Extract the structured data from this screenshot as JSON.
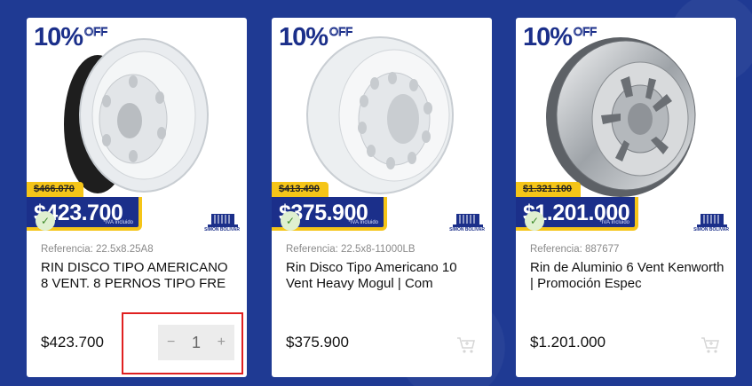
{
  "products": [
    {
      "discount": "10%",
      "off": "OFF",
      "old_price": "$466.070",
      "sale_price": "$423.700",
      "iva_note": "*IVA Incluido",
      "reference": "Referencia: 22.5x8.25A8",
      "name": "RIN DISCO TIPO AMERICANO 8 VENT. 8 PERNOS TIPO FRE",
      "price": "$423.700",
      "quantity": "1",
      "brand": "SIMON BOLIVAR",
      "wheel_color": "#e9ecef"
    },
    {
      "discount": "10%",
      "off": "OFF",
      "old_price": "$413.490",
      "sale_price": "$375.900",
      "iva_note": "*IVA Incluido",
      "reference": "Referencia: 22.5x8-11000LB",
      "name": "Rin Disco Tipo Americano 10 Vent Heavy Mogul | Com",
      "price": "$375.900",
      "brand": "SIMON BOLIVAR",
      "wheel_color": "#eceff1"
    },
    {
      "discount": "10%",
      "off": "OFF",
      "old_price": "$1.321.100",
      "sale_price": "$1.201.000",
      "iva_note": "*IVA Incluido",
      "reference": "Referencia: 887677",
      "name": "Rin de Aluminio 6 Vent Kenworth | Promoción Espec",
      "price": "$1.201.000",
      "brand": "SIMON BOLIVAR",
      "wheel_color": "#c9ccd0"
    }
  ],
  "stepper": {
    "minus": "−",
    "plus": "+"
  },
  "colors": {
    "background": "#1f3a93",
    "badge": "#1b2f8a",
    "accent": "#f5c518",
    "highlight": "#e02020"
  },
  "icons": {
    "cart": "cart-icon",
    "check": "check-icon"
  }
}
